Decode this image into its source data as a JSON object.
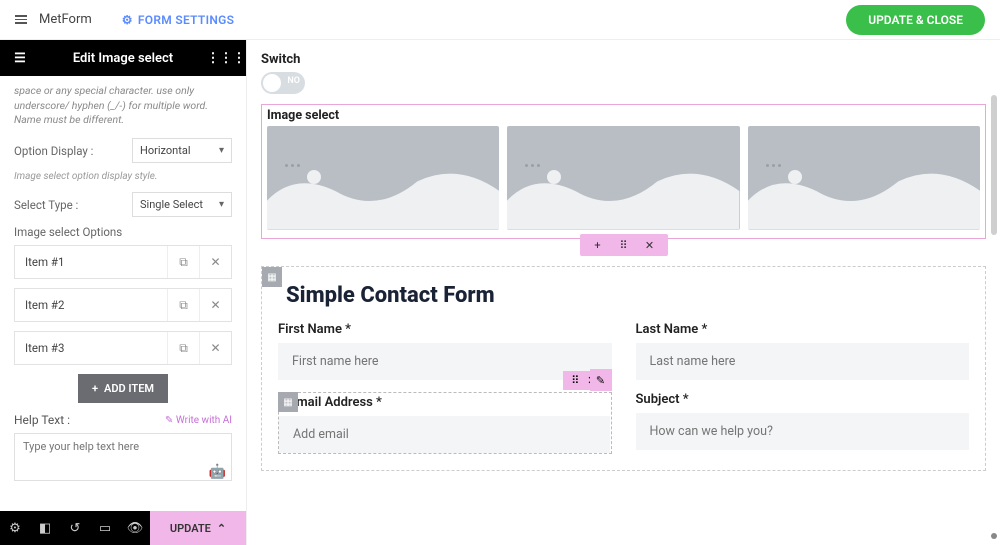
{
  "header": {
    "app_name": "MetForm",
    "form_settings": "FORM SETTINGS",
    "update_close": "UPDATE & CLOSE"
  },
  "panel": {
    "title": "Edit Image select",
    "name_hint": "space or any special character. use only underscore/ hyphen (_/-) for multiple word. Name must be different.",
    "option_display_label": "Option Display :",
    "option_display_value": "Horizontal",
    "option_display_hint": "Image select option display style.",
    "select_type_label": "Select Type :",
    "select_type_value": "Single Select",
    "options_label": "Image select Options",
    "items": [
      {
        "label": "Item #1"
      },
      {
        "label": "Item #2"
      },
      {
        "label": "Item #3"
      }
    ],
    "add_item": "ADD ITEM",
    "help_text_label": "Help Text :",
    "write_with_ai": "✎ Write with AI",
    "help_placeholder": "Type your help text here"
  },
  "footer": {
    "update": "UPDATE"
  },
  "canvas": {
    "switch_label": "Switch",
    "switch_no": "NO",
    "image_select_label": "Image select",
    "contact_title": "Simple Contact Form",
    "fields": {
      "first_name_label": "First Name *",
      "first_name_ph": "First name here",
      "last_name_label": "Last Name *",
      "last_name_ph": "Last name here",
      "email_label": "Email Address *",
      "email_ph": "Add email",
      "subject_label": "Subject *",
      "subject_ph": "How can we help you?"
    }
  }
}
